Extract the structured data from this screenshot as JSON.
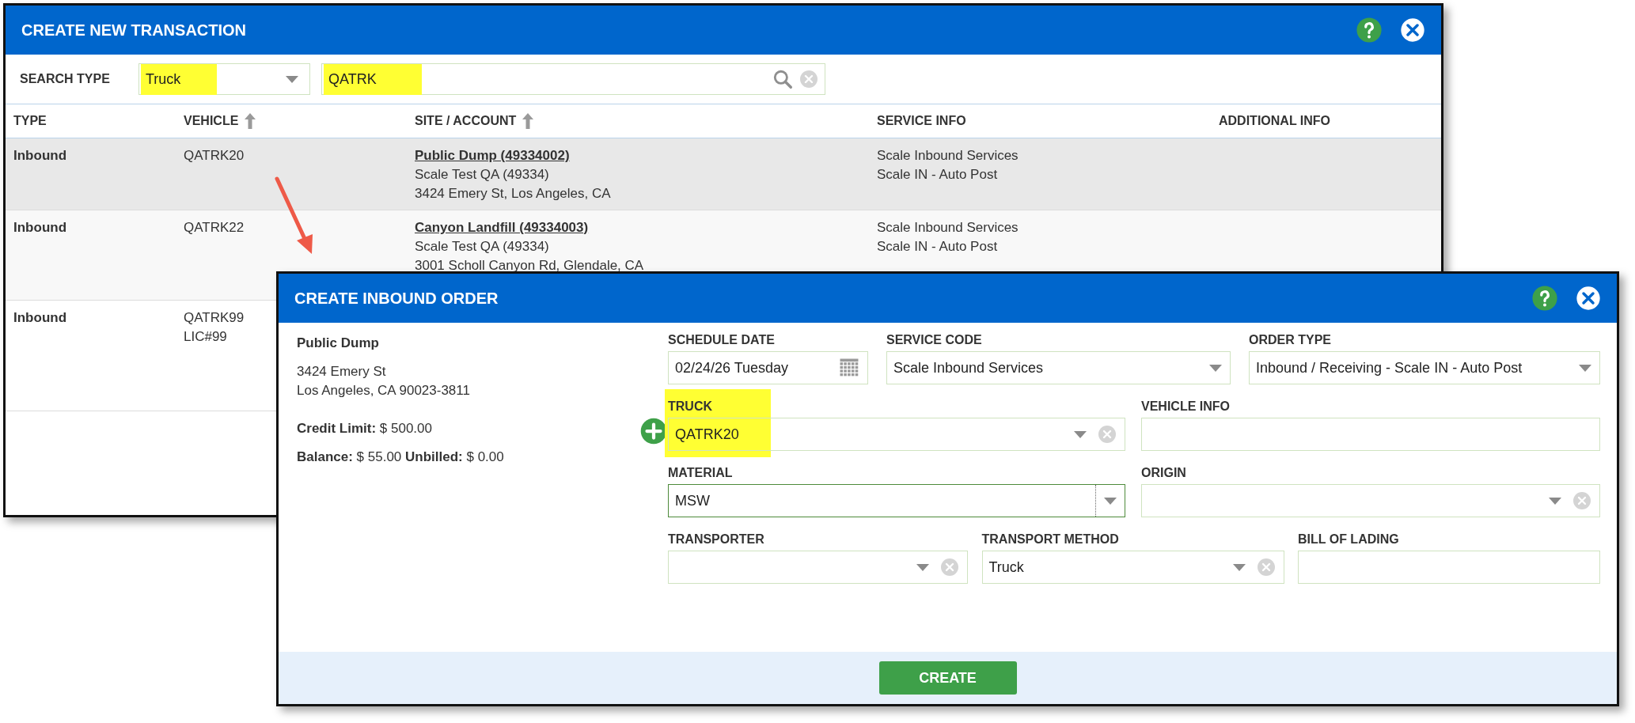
{
  "transaction_dialog": {
    "title": "CREATE NEW TRANSACTION",
    "search": {
      "label": "SEARCH TYPE",
      "type": {
        "value": "Truck",
        "highlighted": true
      },
      "query": {
        "value": "QATRK",
        "highlighted": true
      }
    },
    "table": {
      "columns": [
        {
          "label": "TYPE",
          "sortable": false
        },
        {
          "label": "VEHICLE",
          "sortable": true
        },
        {
          "label": "SITE / ACCOUNT",
          "sortable": true
        },
        {
          "label": "SERVICE INFO",
          "sortable": false
        },
        {
          "label": "ADDITIONAL INFO",
          "sortable": false
        }
      ],
      "rows": [
        {
          "selected": true,
          "type": "Inbound",
          "vehicle": [
            "QATRK20"
          ],
          "site_link": "Public Dump (49334002)",
          "site_lines": [
            "Scale Test QA (49334)",
            "3424 Emery St, Los Angeles, CA"
          ],
          "service": [
            "Scale Inbound Services",
            "Scale IN - Auto Post"
          ]
        },
        {
          "selected": false,
          "type": "Inbound",
          "vehicle": [
            "QATRK22"
          ],
          "site_link": "Canyon Landfill (49334003)",
          "site_lines": [
            "Scale Test QA (49334)",
            "3001 Scholl Canyon Rd, Glendale, CA"
          ],
          "service": [
            "Scale Inbound Services",
            "Scale IN - Auto Post"
          ]
        },
        {
          "selected": false,
          "type": "Inbound",
          "vehicle": [
            "QATRK99",
            "LIC#99"
          ]
        }
      ]
    }
  },
  "order_dialog": {
    "title": "CREATE INBOUND ORDER",
    "customer": {
      "name": "Public Dump",
      "address": [
        "3424 Emery St",
        "Los Angeles, CA 90023-3811"
      ],
      "credit": "**Credit Limit:** $ 500.00",
      "balance": "**Balance:** $ 55.00 **Unbilled:** $ 0.00"
    },
    "rows": [
      [
        {
          "kind": "date",
          "label": "SCHEDULE DATE",
          "value": "02/24/26 Tuesday"
        },
        {
          "kind": "select",
          "label": "SERVICE CODE",
          "value": "Scale Inbound Services"
        },
        {
          "kind": "select",
          "label": "ORDER TYPE",
          "value": "Inbound / Receiving - Scale IN - Auto Post"
        }
      ],
      [
        {
          "kind": "combo",
          "label": "TRUCK",
          "value": "QATRK20",
          "highlighted": true,
          "addable": true
        },
        {
          "kind": "text",
          "label": "VEHICLE INFO"
        }
      ],
      [
        {
          "kind": "select",
          "label": "MATERIAL",
          "value": "MSW",
          "focused": true
        },
        {
          "kind": "combo",
          "label": "ORIGIN"
        }
      ],
      [
        {
          "kind": "combo",
          "label": "TRANSPORTER"
        },
        {
          "kind": "combo",
          "label": "TRANSPORT METHOD",
          "value": "Truck"
        },
        {
          "kind": "text",
          "label": "BILL OF LADING"
        }
      ]
    ],
    "create_button": "CREATE"
  }
}
